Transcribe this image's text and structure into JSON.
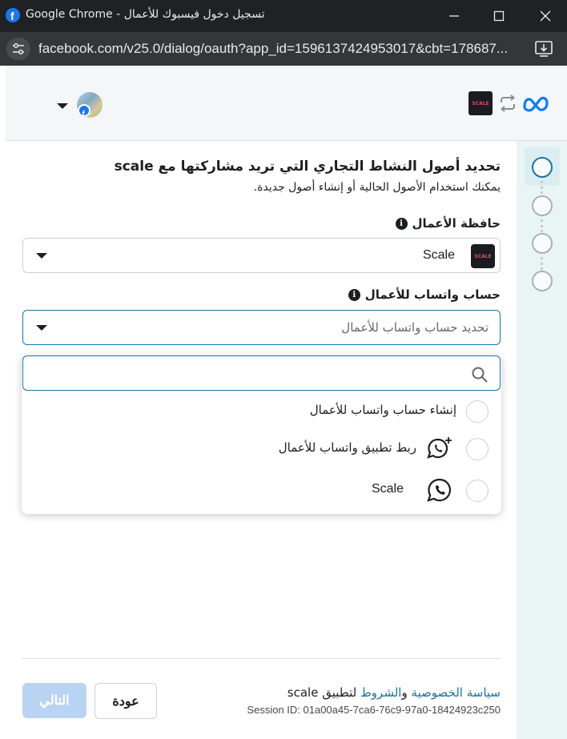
{
  "window": {
    "title": "Google Chrome - تسجيل دخول فيسبوك للأعمال",
    "url": "facebook.com/v25.0/dialog/oauth?app_id=1596137424953017&cbt=178687..."
  },
  "header": {
    "app_logo_text": "SCALE"
  },
  "main": {
    "heading": "تحديد أصول النشاط التجاري التي تريد مشاركتها مع scale",
    "subheading": "يمكنك استخدام الأصول الحالية أو إنشاء أصول جديدة.",
    "business_portfolio": {
      "label": "حافظة الأعمال",
      "selected": "Scale"
    },
    "whatsapp_account": {
      "label": "حساب واتساب للأعمال",
      "placeholder": "تحديد حساب واتساب للأعمال"
    },
    "dropdown": {
      "search_value": "",
      "options": [
        {
          "label": "إنشاء حساب واتساب للأعمال",
          "icon": "none"
        },
        {
          "label": "ربط تطبيق واتساب للأعمال",
          "icon": "whatsapp-add-icon"
        },
        {
          "label": "Scale",
          "icon": "whatsapp-icon"
        }
      ]
    }
  },
  "footer": {
    "privacy_link": "سياسة الخصوصية",
    "and": " و",
    "terms_link": "الشروط",
    "app_suffix": " لتطبيق scale",
    "session": "Session ID: 01a00a45-7ca6-76c9-97a0-18424923c250",
    "next_button": "التالي",
    "back_button": "عودة"
  },
  "stepper": {
    "steps": 4,
    "active_step": 1
  },
  "colors": {
    "accent": "#1a73a5",
    "next_disabled": "#b9d4f3",
    "facebook_blue": "#1877f2",
    "stepper_bg": "#e9f4f5"
  }
}
